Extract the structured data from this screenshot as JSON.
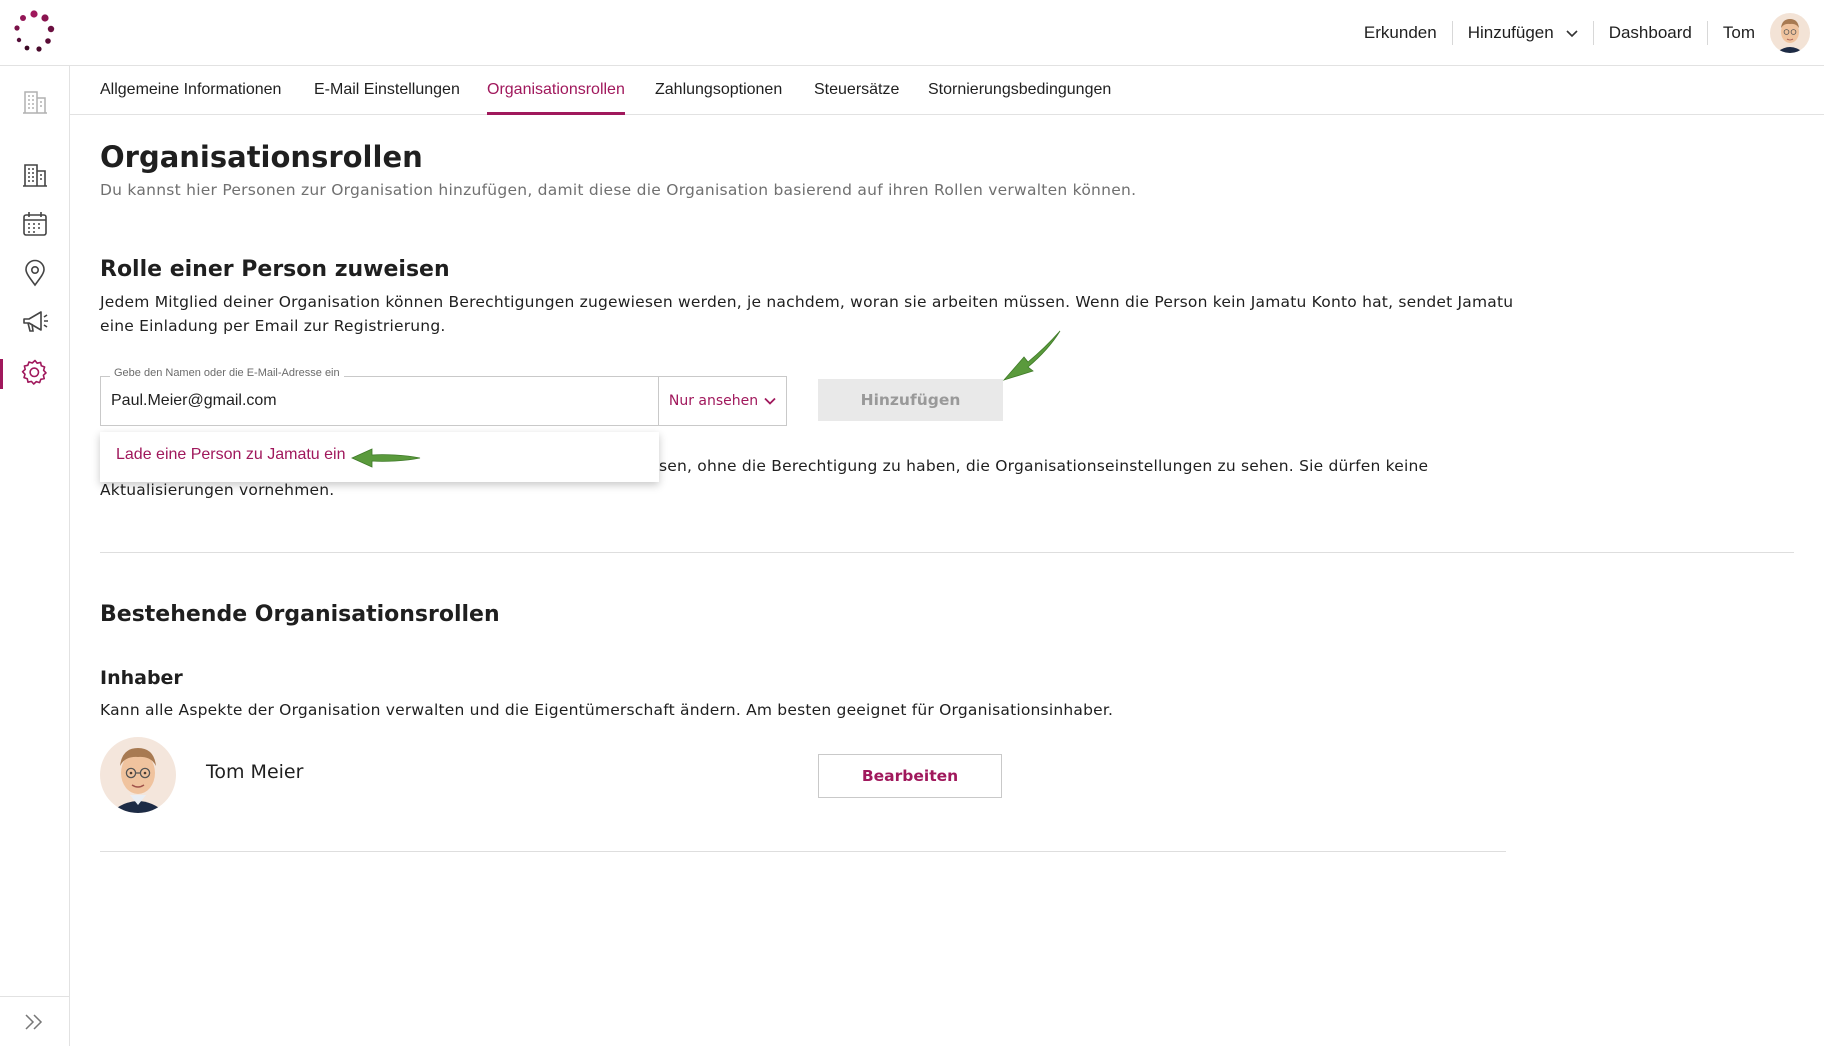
{
  "header": {
    "nav": {
      "explore": "Erkunden",
      "add": "Hinzufügen",
      "dashboard": "Dashboard",
      "user": "Tom"
    }
  },
  "sidebar": {
    "icons": [
      "building-icon",
      "building-icon",
      "calendar-icon",
      "location-pin-icon",
      "megaphone-icon",
      "gear-icon",
      "double-chevron-right-icon"
    ],
    "active": "gear-icon"
  },
  "tabs": [
    {
      "label": "Allgemeine Informationen"
    },
    {
      "label": "E-Mail Einstellungen"
    },
    {
      "label": "Organisationsrollen"
    },
    {
      "label": "Zahlungsoptionen"
    },
    {
      "label": "Steuersätze"
    },
    {
      "label": "Stornierungsbedingungen"
    }
  ],
  "active_tab": "Organisationsrollen",
  "page": {
    "title": "Organisationsrollen",
    "subtitle": "Du kannst hier Personen zur Organisation hinzufügen, damit diese die Organisation basierend auf ihren Rollen verwalten können."
  },
  "assign": {
    "heading": "Rolle einer Person zuweisen",
    "description_line1": "Jedem Mitglied deiner Organisation können Berechtigungen zugewiesen werden, je nachdem, woran sie arbeiten müssen. Wenn die Person kein Jamatu Konto hat, sendet Jamatu",
    "description_line2": "eine Einladung per Email zur Registrierung.",
    "field_label": "Gebe den Namen oder die E-Mail-Adresse ein",
    "field_value": "Paul.Meier@gmail.com",
    "role_selected": "Nur ansehen",
    "add_button": "Hinzufügen",
    "dropdown_option": "Lade eine Person zu Jamatu ein",
    "role_info_line1": "sen, ohne die Berechtigung zu haben, die Organisationseinstellungen zu sehen. Sie dürfen keine",
    "role_info_line2": "Aktualisierungen vornehmen."
  },
  "existing": {
    "heading": "Bestehende Organisationsrollen",
    "role_title": "Inhaber",
    "role_description": "Kann alle Aspekte der Organisation verwalten und die Eigentümerschaft ändern. Am besten geeignet für Organisationsinhaber.",
    "member_name": "Tom Meier",
    "edit_button": "Bearbeiten"
  },
  "colors": {
    "accent": "#a0185c",
    "annotation_arrow": "#5a9a3c",
    "disabled_button_bg": "#e9e9e9"
  }
}
